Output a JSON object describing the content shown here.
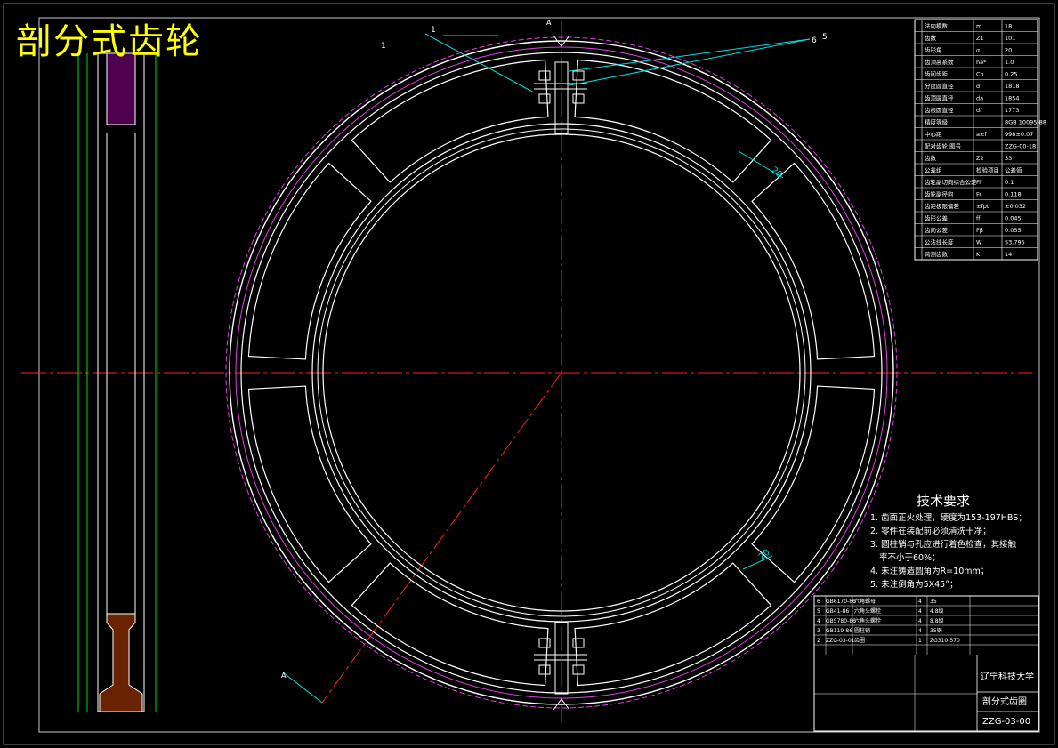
{
  "title_overlay": "剖分式齿轮",
  "tech_requirements": {
    "heading": "技术要求",
    "items": [
      "1. 齿面正火处理，硬度为153-197HBS；",
      "2. 零件在装配前必须清洗干净；",
      "3. 圆柱销与孔应进行着色检查，其接触",
      "率不小于60%；",
      "4. 未注铸造圆角为R=10mm；",
      "5. 未注倒角为5X45°；"
    ]
  },
  "callouts": {
    "c1": "1",
    "c1b": "1",
    "c5": "5",
    "c6": "6",
    "sectionA_top": "A",
    "sectionA_bottom": "A",
    "dim_20_top": "20",
    "dim_20_bottom": "20"
  },
  "param_table": {
    "rows": [
      [
        "法向模数",
        "m",
        "18"
      ],
      [
        "齿数",
        "Z1",
        "101"
      ],
      [
        "齿形角",
        "α",
        "20"
      ],
      [
        "齿顶高系数",
        "ha*",
        "1.0"
      ],
      [
        "齿间齿距",
        "Cn",
        "0.25"
      ],
      [
        "分度圆直径",
        "d",
        "1818"
      ],
      [
        "齿顶圆直径",
        "da",
        "1854"
      ],
      [
        "齿根圆直径",
        "df",
        "1773"
      ],
      [
        "精度等级",
        "",
        "8GB 10095-88"
      ],
      [
        "中心距",
        "a±f",
        "998±0.07"
      ],
      [
        "配对齿轮 图号",
        "",
        "ZZG-00-18"
      ],
      [
        "齿数",
        "Z2",
        "33"
      ],
      [
        "公差组",
        "检验项目",
        "公差值"
      ],
      [
        "齿轮副切向综合公差",
        "Fi'",
        "0.1"
      ],
      [
        "齿轮副径向",
        "Fr",
        "0.118"
      ],
      [
        "齿距极限偏差",
        "±fpt",
        "±0.032"
      ],
      [
        "齿形公差",
        "ff",
        "0.045"
      ],
      [
        "齿向公差",
        "Fβ",
        "0.055"
      ],
      [
        "公法线长度",
        "W",
        "53.795"
      ],
      [
        "跨测齿数",
        "K",
        "14"
      ]
    ]
  },
  "title_block": {
    "school": "辽宁科技大学",
    "drawing_name": "剖分式齿圈",
    "drawing_number": "ZZG-03-00",
    "parts": [
      [
        "6",
        "GB6170-86",
        "六角螺母",
        "4",
        "35"
      ],
      [
        "5",
        "GB41-86",
        "六角头螺栓",
        "4",
        "4.8级"
      ],
      [
        "4",
        "GB5780-86",
        "六角头螺栓",
        "4",
        "8.8级"
      ],
      [
        "3",
        "GB119-86",
        "圆柱销",
        "4",
        "35钢"
      ],
      [
        "2",
        "ZZG-03-01",
        "齿圈",
        "1",
        "ZG310-570"
      ]
    ]
  }
}
